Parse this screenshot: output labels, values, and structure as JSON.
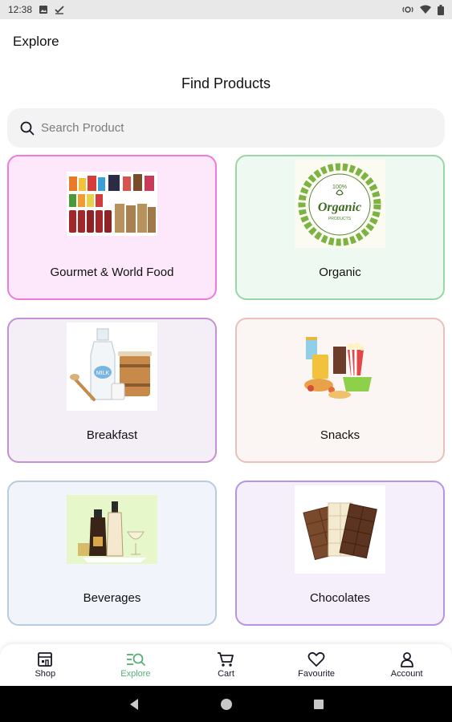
{
  "status_bar": {
    "time": "12:38",
    "icons": [
      "image-icon",
      "check-icon",
      "vibrate-icon",
      "wifi-icon",
      "battery-icon"
    ]
  },
  "app_bar": {
    "title": "Explore"
  },
  "page": {
    "title": "Find Products"
  },
  "search": {
    "placeholder": "Search Product",
    "value": ""
  },
  "categories": [
    {
      "label": "Gourmet & World Food",
      "bg": "#fde8fb",
      "border": "#f07ad8",
      "icon": "gourmet-products-image"
    },
    {
      "label": "Organic",
      "bg": "#eefaf1",
      "border": "#9ad6a8",
      "icon": "organic-badge-image",
      "badge_top": "100%",
      "badge_main": "Organic",
      "badge_sub": "PRODUCTS"
    },
    {
      "label": "Breakfast",
      "bg": "#f4eff6",
      "border": "#c591d6",
      "icon": "milk-breakfast-image",
      "bottle_text": "MILK"
    },
    {
      "label": "Snacks",
      "bg": "#fbf5f4",
      "border": "#e9c0bb",
      "icon": "snacks-image"
    },
    {
      "label": "Beverages",
      "bg": "#f1f5fb",
      "border": "#b8cbe0",
      "icon": "beverages-image"
    },
    {
      "label": "Chocolates",
      "bg": "#f4effb",
      "border": "#b694e5",
      "icon": "chocolates-image"
    }
  ],
  "bottom_nav": {
    "active_color": "#53b175",
    "items": [
      {
        "label": "Shop",
        "icon": "shop-icon"
      },
      {
        "label": "Explore",
        "icon": "explore-icon",
        "active": true
      },
      {
        "label": "Cart",
        "icon": "cart-icon"
      },
      {
        "label": "Favourite",
        "icon": "heart-icon"
      },
      {
        "label": "Account",
        "icon": "account-icon"
      }
    ]
  },
  "system_nav": {
    "icons": [
      "back-icon",
      "home-icon",
      "recents-icon"
    ]
  }
}
